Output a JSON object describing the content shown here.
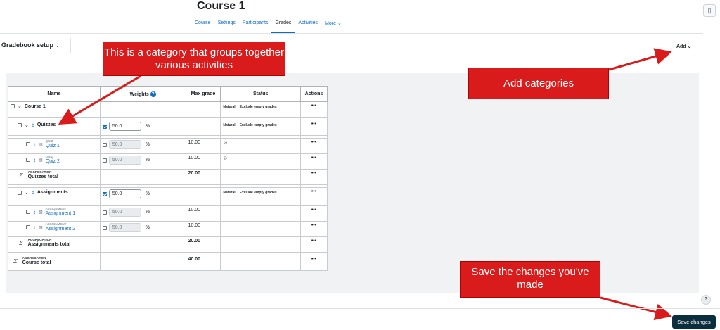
{
  "course": {
    "title": "Course 1"
  },
  "nav": {
    "tabs": [
      "Course",
      "Settings",
      "Participants",
      "Grades",
      "Activities",
      "More ⌄"
    ],
    "active": "Grades"
  },
  "toolbar": {
    "gradebook_setup": "Gradebook setup",
    "add_label": "Add"
  },
  "table": {
    "headers": {
      "name": "Name",
      "weights": "Weights",
      "max_grade": "Max grade",
      "status": "Status",
      "actions": "Actions"
    },
    "course_row": {
      "name": "Course 1",
      "status_natural": "Natural",
      "status_exclude": "Exclude empty grades",
      "actions": "•••"
    },
    "quizzes": {
      "name": "Quizzes",
      "weight": "50.0",
      "pct": "%",
      "status_natural": "Natural",
      "status_exclude": "Exclude empty grades",
      "actions": "•••",
      "items": [
        {
          "type": "QUIZ",
          "name": "Quiz 1",
          "weight": "50.0",
          "pct": "%",
          "max": "10.00",
          "actions": "•••"
        },
        {
          "type": "QUIZ",
          "name": "Quiz 2",
          "weight": "50.0",
          "pct": "%",
          "max": "10.00",
          "actions": "•••"
        }
      ],
      "total": {
        "agg": "AGGREGATION",
        "name": "Quizzes total",
        "max": "20.00",
        "actions": "•••"
      }
    },
    "assignments": {
      "name": "Assignments",
      "weight": "50.0",
      "pct": "%",
      "status_natural": "Natural",
      "status_exclude": "Exclude empty grades",
      "actions": "•••",
      "items": [
        {
          "type": "ASSIGNMENT",
          "name": "Assignment 1",
          "weight": "50.0",
          "pct": "%",
          "max": "10.00",
          "actions": "•••"
        },
        {
          "type": "ASSIGNMENT",
          "name": "Assignment 2",
          "weight": "50.0",
          "pct": "%",
          "max": "10.00",
          "actions": "•••"
        }
      ],
      "total": {
        "agg": "AGGREGATION",
        "name": "Assignments total",
        "max": "20.00",
        "actions": "•••"
      }
    },
    "course_total": {
      "agg": "AGGREGATION",
      "name": "Course total",
      "max": "40.00",
      "actions": "•••"
    }
  },
  "callouts": {
    "category": "This is a category that groups together various activities",
    "add": "Add categories",
    "save": "Save the changes you've made"
  },
  "footer": {
    "help": "?",
    "save_label": "Save changes"
  },
  "colors": {
    "callout": "#d91b1b",
    "link": "#0f6cbf",
    "primary_button": "#0b2e3f"
  }
}
